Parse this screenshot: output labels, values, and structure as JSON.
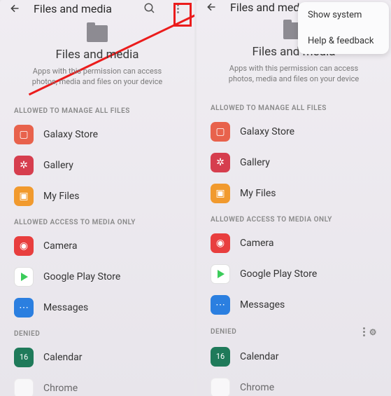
{
  "appbar": {
    "title": "Files and media"
  },
  "header": {
    "title": "Files and media",
    "subtitle": "Apps with this permission can access photos, media and files on your device"
  },
  "sections": {
    "manage": "ALLOWED TO MANAGE ALL FILES",
    "media": "ALLOWED ACCESS TO MEDIA ONLY",
    "denied": "DENIED"
  },
  "apps": {
    "galaxy": "Galaxy Store",
    "gallery": "Gallery",
    "myfiles": "My Files",
    "camera": "Camera",
    "play": "Google Play Store",
    "messages": "Messages",
    "calendar": "Calendar",
    "chrome": "Chrome"
  },
  "menu": {
    "show_system": "Show system",
    "help": "Help & feedback"
  }
}
